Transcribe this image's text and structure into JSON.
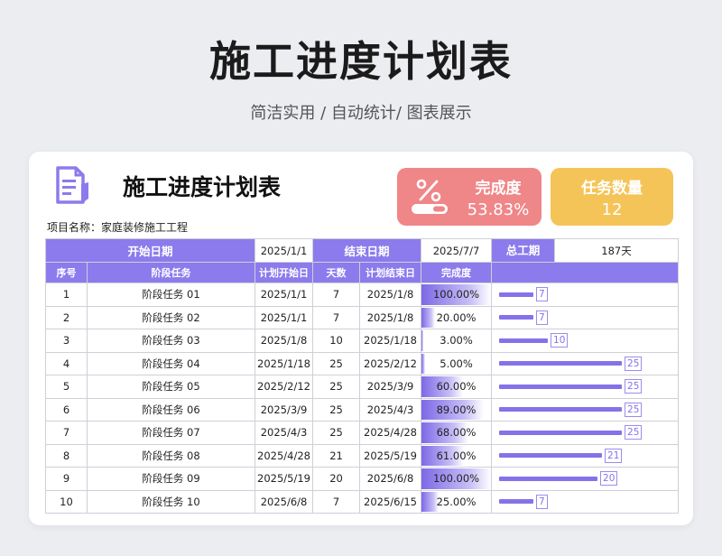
{
  "header": {
    "title": "施工进度计划表",
    "subtitle": "简洁实用 / 自动统计/ 图表展示"
  },
  "card": {
    "title": "施工进度计划表",
    "project": "项目名称：家庭装修施工工程",
    "stats": {
      "completion_label": "完成度",
      "completion_value": "53.83%",
      "task_count_label": "任务数量",
      "task_count_value": "12"
    }
  },
  "info": {
    "start_label": "开始日期",
    "start_value": "2025/1/1",
    "end_label": "结束日期",
    "end_value": "2025/7/7",
    "total_label": "总工期",
    "total_value": "187天"
  },
  "columns": [
    "序号",
    "阶段任务",
    "计划开始日",
    "天数",
    "计划结束日",
    "完成度",
    ""
  ],
  "rows": [
    {
      "no": "1",
      "task": "阶段任务 01",
      "start": "2025/1/1",
      "days": "7",
      "end": "2025/1/8",
      "pct": "100.00%",
      "pct_val": 1.0,
      "dur": 7
    },
    {
      "no": "2",
      "task": "阶段任务 02",
      "start": "2025/1/1",
      "days": "7",
      "end": "2025/1/8",
      "pct": "20.00%",
      "pct_val": 0.2,
      "dur": 7
    },
    {
      "no": "3",
      "task": "阶段任务 03",
      "start": "2025/1/8",
      "days": "10",
      "end": "2025/1/18",
      "pct": "3.00%",
      "pct_val": 0.03,
      "dur": 10
    },
    {
      "no": "4",
      "task": "阶段任务 04",
      "start": "2025/1/18",
      "days": "25",
      "end": "2025/2/12",
      "pct": "5.00%",
      "pct_val": 0.05,
      "dur": 25
    },
    {
      "no": "5",
      "task": "阶段任务 05",
      "start": "2025/2/12",
      "days": "25",
      "end": "2025/3/9",
      "pct": "60.00%",
      "pct_val": 0.6,
      "dur": 25
    },
    {
      "no": "6",
      "task": "阶段任务 06",
      "start": "2025/3/9",
      "days": "25",
      "end": "2025/4/3",
      "pct": "89.00%",
      "pct_val": 0.89,
      "dur": 25
    },
    {
      "no": "7",
      "task": "阶段任务 07",
      "start": "2025/4/3",
      "days": "25",
      "end": "2025/4/28",
      "pct": "68.00%",
      "pct_val": 0.68,
      "dur": 25
    },
    {
      "no": "8",
      "task": "阶段任务 08",
      "start": "2025/4/28",
      "days": "21",
      "end": "2025/5/19",
      "pct": "61.00%",
      "pct_val": 0.61,
      "dur": 21
    },
    {
      "no": "9",
      "task": "阶段任务 09",
      "start": "2025/5/19",
      "days": "20",
      "end": "2025/6/8",
      "pct": "100.00%",
      "pct_val": 1.0,
      "dur": 20
    },
    {
      "no": "10",
      "task": "阶段任务 10",
      "start": "2025/6/8",
      "days": "7",
      "end": "2025/6/15",
      "pct": "25.00%",
      "pct_val": 0.25,
      "dur": 7
    }
  ],
  "colors": {
    "accent": "#8c7bec",
    "completion_card": "#ef8688",
    "count_card": "#f5c458"
  }
}
